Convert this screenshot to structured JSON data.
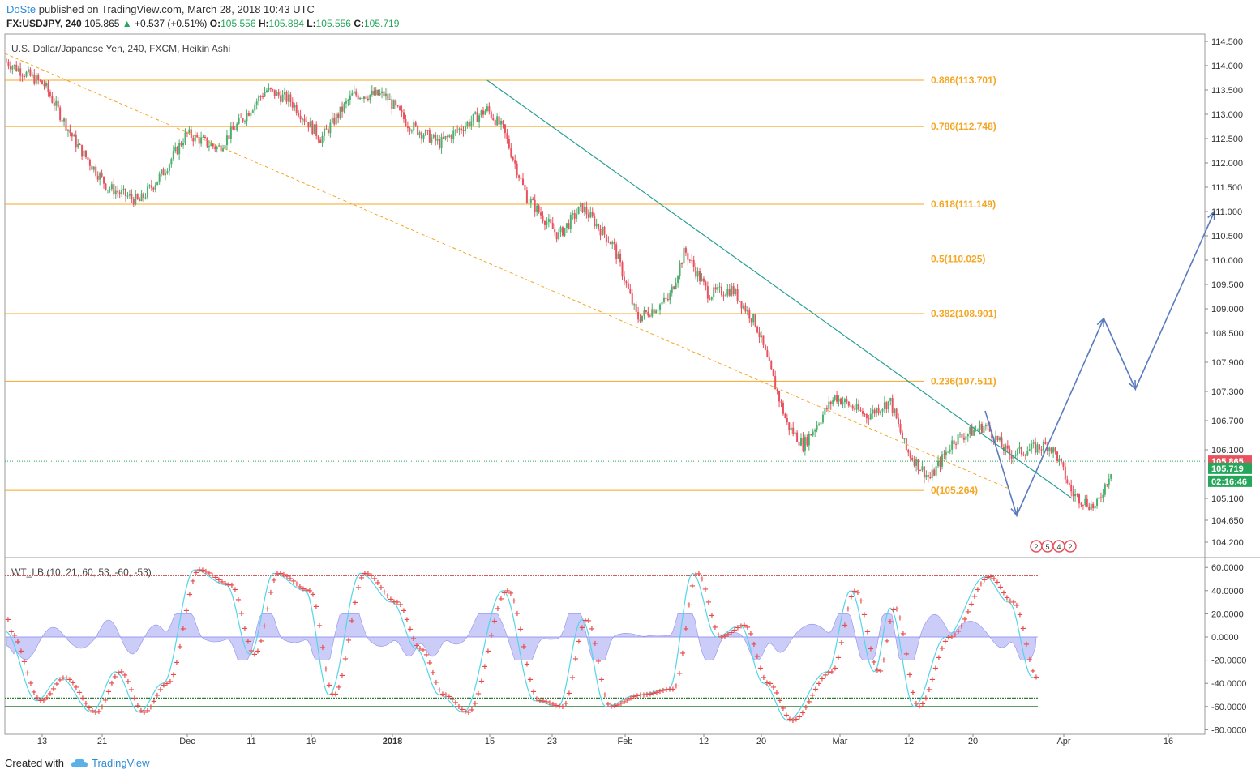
{
  "header": {
    "author": "DoSte",
    "published": "published on TradingView.com, March 28, 2018 10:43 UTC",
    "symbol": "FX:USDJPY, 240",
    "last": "105.865",
    "change": "+0.537 (+0.51%)",
    "o_label": "O:",
    "o": "105.556",
    "h_label": "H:",
    "h": "105.884",
    "l_label": "L:",
    "l": "105.556",
    "c_label": "C:",
    "c": "105.719"
  },
  "symbol_title": "U.S. Dollar/Japanese Yen, 240, FXCM, Heikin Ashi",
  "indicator_title": "WT_LB (10, 21, 60, 53, -60, -53)",
  "footer": {
    "created": "Created with",
    "brand": "TradingView"
  },
  "colors": {
    "bull": "#4caf6e",
    "bear": "#e8515e",
    "fib": "#f5a623",
    "trend": "#2aa198",
    "arrow": "#5b7bbf",
    "wt1": "#52d6e8",
    "wt2": "#e84a4a",
    "hist": "#8f8ff0",
    "level_red": "#c62828",
    "level_green": "#2e7d32"
  },
  "chart_data": [
    {
      "type": "candlestick",
      "title": "U.S. Dollar/Japanese Yen, 240, FXCM, Heikin Ashi",
      "ylim": [
        104.2,
        114.5
      ],
      "y_ticks": [
        "114.500",
        "114.000",
        "113.500",
        "113.000",
        "112.500",
        "112.000",
        "111.500",
        "111.000",
        "110.500",
        "110.000",
        "109.500",
        "109.000",
        "108.500",
        "107.900",
        "107.300",
        "106.700",
        "106.100",
        "105.100",
        "104.650",
        "104.200"
      ],
      "x_ticks": [
        "13",
        "21",
        "Dec",
        "11",
        "19",
        "2018",
        "15",
        "23",
        "Feb",
        "12",
        "20",
        "Mar",
        "12",
        "20",
        "Apr",
        "16"
      ],
      "price_path": [
        [
          "Nov 8",
          114.1
        ],
        [
          "Nov 13",
          113.6
        ],
        [
          "Nov 17",
          112.4
        ],
        [
          "Nov 21",
          111.5
        ],
        [
          "Nov 25",
          111.2
        ],
        [
          "Nov 28",
          111.8
        ],
        [
          "Dec 1",
          112.6
        ],
        [
          "Dec 5",
          112.3
        ],
        [
          "Dec 11",
          113.5
        ],
        [
          "Dec 14",
          113.3
        ],
        [
          "Dec 18",
          112.5
        ],
        [
          "Dec 22",
          113.4
        ],
        [
          "Dec 26",
          113.4
        ],
        [
          "Dec 29",
          112.8
        ],
        [
          "Jan 2",
          112.4
        ],
        [
          "Jan 8",
          113.1
        ],
        [
          "Jan 10",
          112.7
        ],
        [
          "Jan 13",
          111.3
        ],
        [
          "Jan 17",
          110.5
        ],
        [
          "Jan 20",
          111.1
        ],
        [
          "Jan 24",
          110.3
        ],
        [
          "Jan 27",
          108.8
        ],
        [
          "Jan 31",
          109.2
        ],
        [
          "Feb 2",
          110.2
        ],
        [
          "Feb 5",
          109.3
        ],
        [
          "Feb 8",
          109.4
        ],
        [
          "Feb 11",
          108.7
        ],
        [
          "Feb 15",
          106.6
        ],
        [
          "Feb 17",
          106.2
        ],
        [
          "Feb 21",
          107.2
        ],
        [
          "Feb 25",
          106.8
        ],
        [
          "Feb 28",
          107.1
        ],
        [
          "Mar 2",
          106.1
        ],
        [
          "Mar 5",
          105.5
        ],
        [
          "Mar 8",
          106.3
        ],
        [
          "Mar 12",
          106.6
        ],
        [
          "Mar 15",
          106.0
        ],
        [
          "Mar 20",
          106.2
        ],
        [
          "Mar 21",
          106.0
        ],
        [
          "Mar 23",
          105.2
        ],
        [
          "Mar 26",
          104.9
        ],
        [
          "Mar 28",
          105.719
        ]
      ],
      "fibonacci": [
        {
          "label": "0.886(113.701)",
          "value": 113.701
        },
        {
          "label": "0.786(112.748)",
          "value": 112.748
        },
        {
          "label": "0.618(111.149)",
          "value": 111.149
        },
        {
          "label": "0.5(110.025)",
          "value": 110.025
        },
        {
          "label": "0.382(108.901)",
          "value": 108.901
        },
        {
          "label": "0.236(107.511)",
          "value": 107.511
        },
        {
          "label": "0(105.264)",
          "value": 105.264
        }
      ],
      "price_labels": [
        {
          "text": "105.865",
          "value": 105.865,
          "color": "#e8515e"
        },
        {
          "text": "105.719",
          "value": 105.719,
          "color": "#26a65b"
        },
        {
          "text": "02:16:46",
          "value": 105.44,
          "color": "#26a65b"
        }
      ],
      "forecast_path": [
        [
          "Mar 12",
          106.9
        ],
        [
          "Mar 16",
          104.75
        ],
        [
          "Mar 27",
          108.8
        ],
        [
          "Mar 31",
          107.35
        ],
        [
          "Apr 10",
          111.0
        ]
      ],
      "event_icons": [
        "2",
        "5",
        "4",
        "2"
      ]
    },
    {
      "type": "line",
      "title": "WT_LB (10, 21, 60, 53, -60, -53)",
      "ylim": [
        -80,
        70
      ],
      "y_ticks": [
        "60.0000",
        "40.0000",
        "20.0000",
        "0.0000",
        "-20.0000",
        "-40.0000",
        "-60.0000",
        "-80.0000"
      ],
      "levels": [
        53,
        -53,
        -60
      ],
      "wt_path": [
        [
          "Nov 8",
          5
        ],
        [
          "Nov 12",
          -55
        ],
        [
          "Nov 15",
          -35
        ],
        [
          "Nov 19",
          -65
        ],
        [
          "Nov 22",
          -30
        ],
        [
          "Nov 25",
          -65
        ],
        [
          "Nov 28",
          -40
        ],
        [
          "Dec 2",
          58
        ],
        [
          "Dec 6",
          45
        ],
        [
          "Dec 9",
          -15
        ],
        [
          "Dec 12",
          55
        ],
        [
          "Dec 16",
          40
        ],
        [
          "Dec 19",
          -50
        ],
        [
          "Dec 23",
          55
        ],
        [
          "Dec 27",
          30
        ],
        [
          "Dec 30",
          -10
        ],
        [
          "Jan 2",
          -50
        ],
        [
          "Jan 5",
          -65
        ],
        [
          "Jan 10",
          40
        ],
        [
          "Jan 14",
          -55
        ],
        [
          "Jan 17",
          -60
        ],
        [
          "Jan 20",
          15
        ],
        [
          "Jan 23",
          -60
        ],
        [
          "Jan 27",
          -50
        ],
        [
          "Jan 31",
          -45
        ],
        [
          "Feb 3",
          55
        ],
        [
          "Feb 6",
          0
        ],
        [
          "Feb 9",
          10
        ],
        [
          "Feb 12",
          -40
        ],
        [
          "Feb 15",
          -72
        ],
        [
          "Feb 20",
          -30
        ],
        [
          "Feb 23",
          40
        ],
        [
          "Feb 26",
          -30
        ],
        [
          "Feb 28",
          25
        ],
        [
          "Mar 3",
          -60
        ],
        [
          "Mar 7",
          0
        ],
        [
          "Mar 12",
          52
        ],
        [
          "Mar 15",
          30
        ],
        [
          "Mar 18",
          -35
        ],
        [
          "Mar 21",
          -40
        ],
        [
          "Mar 23",
          25
        ],
        [
          "Mar 27",
          -50
        ],
        [
          "Mar 28",
          15
        ]
      ]
    }
  ]
}
